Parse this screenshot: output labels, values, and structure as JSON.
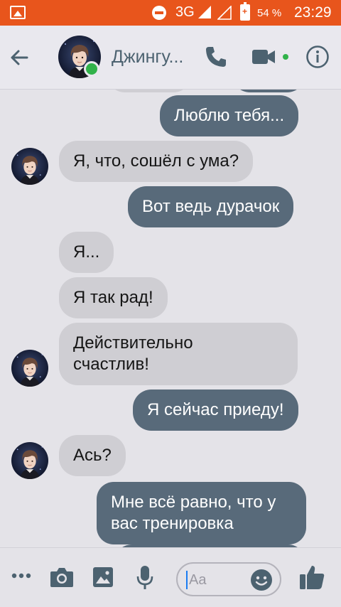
{
  "status_bar": {
    "network": "3G",
    "battery": "54 %",
    "time": "23:29"
  },
  "header": {
    "contact_name": "Джингу...",
    "online": true
  },
  "messages": [
    {
      "from": "me",
      "text": "Люблю тебя..."
    },
    {
      "from": "them",
      "text": "Я, что, сошёл с ума?"
    },
    {
      "from": "me",
      "text": "Вот ведь дурачок"
    },
    {
      "from": "them",
      "text": "Я..."
    },
    {
      "from": "them",
      "text": "Я так рад!"
    },
    {
      "from": "them",
      "text": "Действительно\nсчастлив!"
    },
    {
      "from": "me",
      "text": "Я сейчас приеду!"
    },
    {
      "from": "them",
      "text": "Ась?"
    },
    {
      "from": "me",
      "text": "Мне всё равно, что у\nвас тренировка"
    }
  ],
  "composer": {
    "placeholder": "Aa"
  },
  "colors": {
    "status_bar": "#e8551c",
    "outgoing_bubble": "#586a7a",
    "incoming_bubble": "#cfced3",
    "accent": "#4c6270",
    "online": "#31b24a"
  },
  "icons": {
    "back": "back-arrow-icon",
    "call": "phone-icon",
    "video": "video-camera-icon",
    "info": "info-icon",
    "more": "more-dots-icon",
    "camera": "camera-icon",
    "gallery": "gallery-icon",
    "voice": "microphone-icon",
    "emoji": "emoji-icon",
    "like": "thumbs-up-icon"
  }
}
